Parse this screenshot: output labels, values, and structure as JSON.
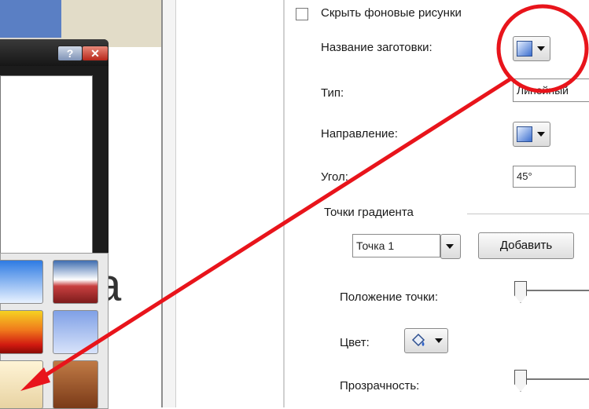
{
  "panel": {
    "hide_background_label": "Скрыть фоновые рисунки",
    "preset_name_label": "Название заготовки:",
    "type_label": "Тип:",
    "type_value": "Линейный",
    "direction_label": "Направление:",
    "angle_label": "Угол:",
    "angle_value": "45°",
    "gradient_stops_label": "Точки градиента",
    "stop_select_value": "Точка 1",
    "add_button": "Добавить",
    "stop_position_label": "Положение точки:",
    "color_label": "Цвет:",
    "transparency_label": "Прозрачность:"
  },
  "dialog": {
    "help_label": "?",
    "close_label": "✕"
  },
  "backdrop": {
    "big_letter": "a"
  },
  "gallery": {
    "swatches": [
      "sky-blue",
      "red-white-blue",
      "fire-orange",
      "lavender-blue",
      "cream",
      "copper-brown"
    ]
  },
  "colors": {
    "annotation_red": "#e8141b",
    "dialog_dark": "#1c1c1c",
    "gradient_blue": "#3b6ecf"
  },
  "icons": [
    "gradient-preset-icon",
    "gradient-direction-icon",
    "paint-bucket-icon",
    "chevron-down-icon",
    "close-icon",
    "help-icon"
  ]
}
